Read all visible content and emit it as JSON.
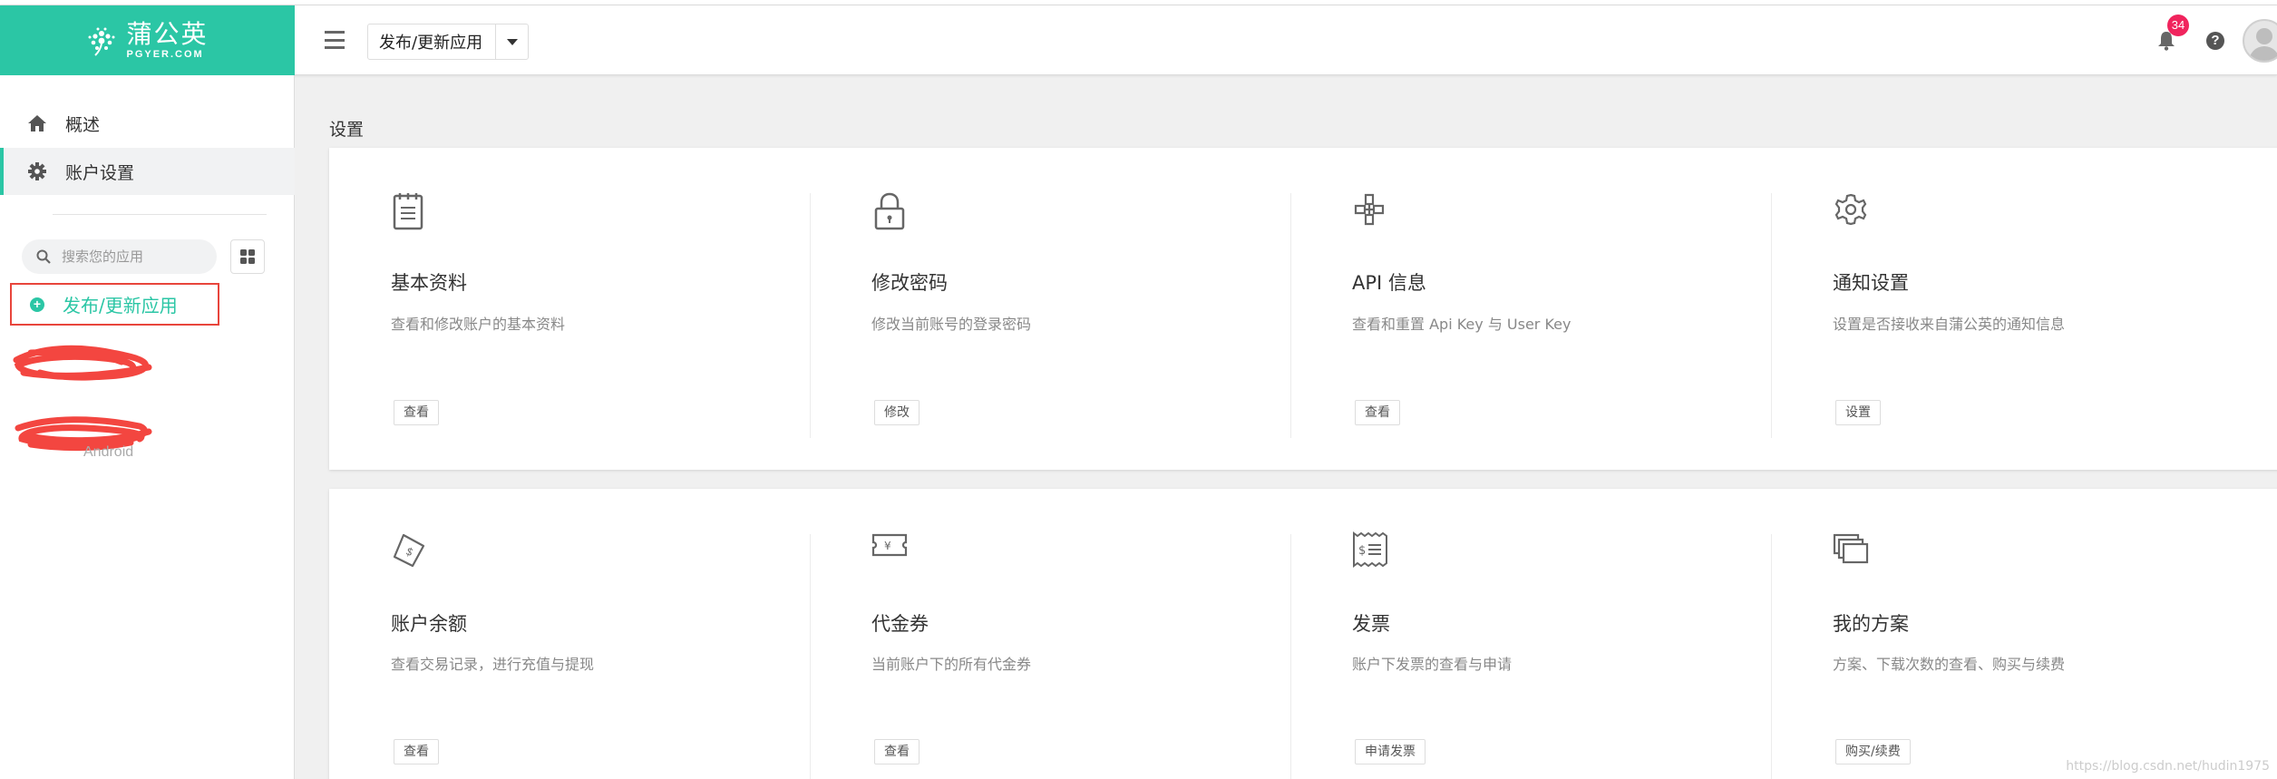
{
  "brand": {
    "name_cn": "蒲公英",
    "name_en": "PGYER.COM",
    "color": "#2bc6a5"
  },
  "header": {
    "app_select_label": "发布/更新应用",
    "notification_count": "34",
    "help_label": "?"
  },
  "sidebar": {
    "items": [
      {
        "label": "概述",
        "icon": "home-icon"
      },
      {
        "label": "账户设置",
        "icon": "gear-icon",
        "active": true
      }
    ],
    "search_placeholder": "搜索您的应用",
    "publish_label": "发布/更新应用",
    "apps": [
      {
        "sub": ""
      },
      {
        "sub": "Android"
      }
    ]
  },
  "main": {
    "title": "设置",
    "cards_row1": [
      {
        "title": "基本资料",
        "desc": "查看和修改账户的基本资料",
        "button": "查看",
        "icon": "notepad-icon"
      },
      {
        "title": "修改密码",
        "desc": "修改当前账号的登录密码",
        "button": "修改",
        "icon": "lock-icon"
      },
      {
        "title": "API 信息",
        "desc": "查看和重置 Api Key 与 User Key",
        "button": "查看",
        "icon": "api-icon"
      },
      {
        "title": "通知设置",
        "desc": "设置是否接收来自蒲公英的通知信息",
        "button": "设置",
        "icon": "settings-icon"
      }
    ],
    "cards_row2": [
      {
        "title": "账户余额",
        "desc": "查看交易记录，进行充值与提现",
        "button": "查看",
        "icon": "wallet-icon"
      },
      {
        "title": "代金券",
        "desc": "当前账户下的所有代金券",
        "button": "查看",
        "icon": "coupon-icon"
      },
      {
        "title": "发票",
        "desc": "账户下发票的查看与申请",
        "button": "申请发票",
        "icon": "invoice-icon"
      },
      {
        "title": "我的方案",
        "desc": "方案、下载次数的查看、购买与续费",
        "button": "购买/续费",
        "icon": "plans-icon"
      }
    ]
  },
  "watermark": "https://blog.csdn.net/hudin1975"
}
